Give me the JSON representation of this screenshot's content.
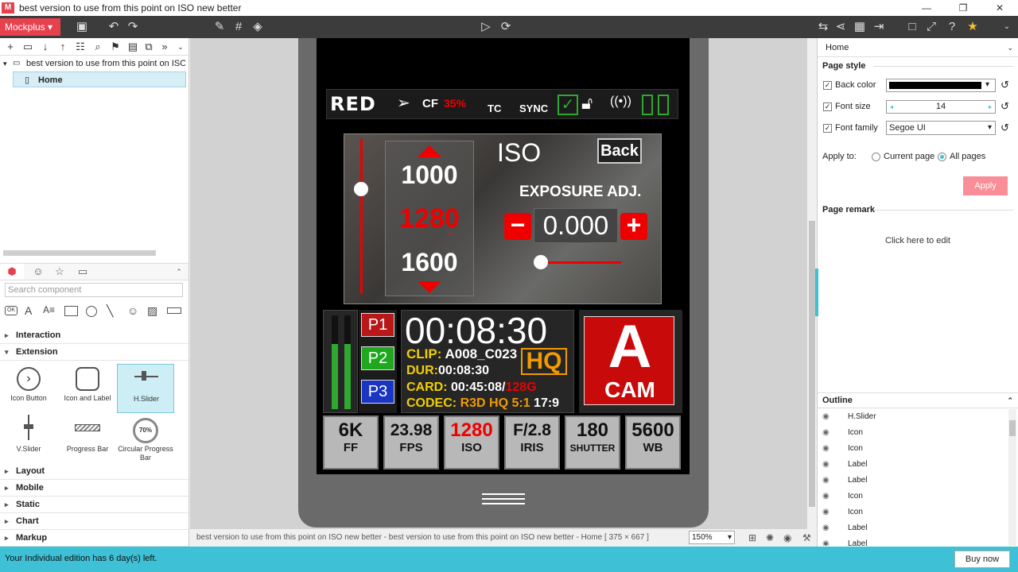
{
  "window": {
    "title": "best version to use from this point on ISO new better",
    "logo": "M"
  },
  "toolbar": {
    "app_button": "Mockplus ▾"
  },
  "tree": {
    "root": "best version to use from this point on ISO new",
    "page": "Home"
  },
  "components": {
    "search_placeholder": "Search component",
    "categories": [
      "Interaction",
      "Extension",
      "Layout",
      "Mobile",
      "Static",
      "Chart",
      "Markup"
    ],
    "items": [
      "Icon Button",
      "Icon and Label",
      "H.Slider",
      "V.Slider",
      "Progress Bar",
      "Circular Progress Bar"
    ],
    "circular_value": "70%"
  },
  "camera": {
    "brand": "RED",
    "cf_label": "CF",
    "cf_value": "35%",
    "tc": "TC",
    "sync": "SYNC",
    "iso_title": "ISO",
    "back": "Back",
    "iso_values": [
      "1000",
      "1280",
      "1600"
    ],
    "exposure_title": "EXPOSURE ADJ.",
    "exposure_value": "0.000",
    "minus": "−",
    "plus": "+",
    "presets": [
      "P1",
      "P2",
      "P3"
    ],
    "timecode": "00:08:30",
    "clip_label": "CLIP:",
    "clip": "A008_C023",
    "dur_label": "DUR:",
    "dur": "00:08:30",
    "card_label": "CARD:",
    "card": "00:45:08/",
    "card_cap": "128G",
    "codec_label": "CODEC:",
    "codec": "R3D HQ 5:1",
    "ratio": "17:9",
    "quality": "HQ",
    "cam_letter": "A",
    "cam_word": "CAM",
    "bottom": [
      {
        "big": "6K",
        "small": "FF"
      },
      {
        "big": "23.98",
        "small": "FPS"
      },
      {
        "big": "1280",
        "small": "ISO"
      },
      {
        "big": "F/2.8",
        "small": "IRIS"
      },
      {
        "big": "180",
        "small": "SHUTTER"
      },
      {
        "big": "5600",
        "small": "WB"
      }
    ],
    "meter_levels": [
      0.72,
      0.72
    ]
  },
  "status": {
    "path": "best version to use from this point on ISO new better - best version to use from this point on ISO new better - Home [ 375 × 667 ]",
    "zoom": "150%"
  },
  "right": {
    "page_name": "Home",
    "page_style": "Page style",
    "back_color_label": "Back color",
    "back_color": "#000000",
    "font_size_label": "Font size",
    "font_size": "14",
    "font_family_label": "Font family",
    "font_family": "Segoe UI",
    "apply_to": "Apply to:",
    "current_page": "Current page",
    "all_pages": "All pages",
    "apply": "Apply",
    "page_remark": "Page remark",
    "remark_hint": "Click here to edit",
    "outline_title": "Outline",
    "outline": [
      "H.Slider",
      "Icon",
      "Icon",
      "Label",
      "Label",
      "Icon",
      "Icon",
      "Label",
      "Label"
    ]
  },
  "footer": {
    "trial": "Your Individual edition has 6 day(s) left.",
    "buy": "Buy now"
  },
  "colors": {
    "accent": "#e8414e",
    "teal": "#3ec0d6",
    "red": "#e00000",
    "green": "#2fa82f"
  }
}
